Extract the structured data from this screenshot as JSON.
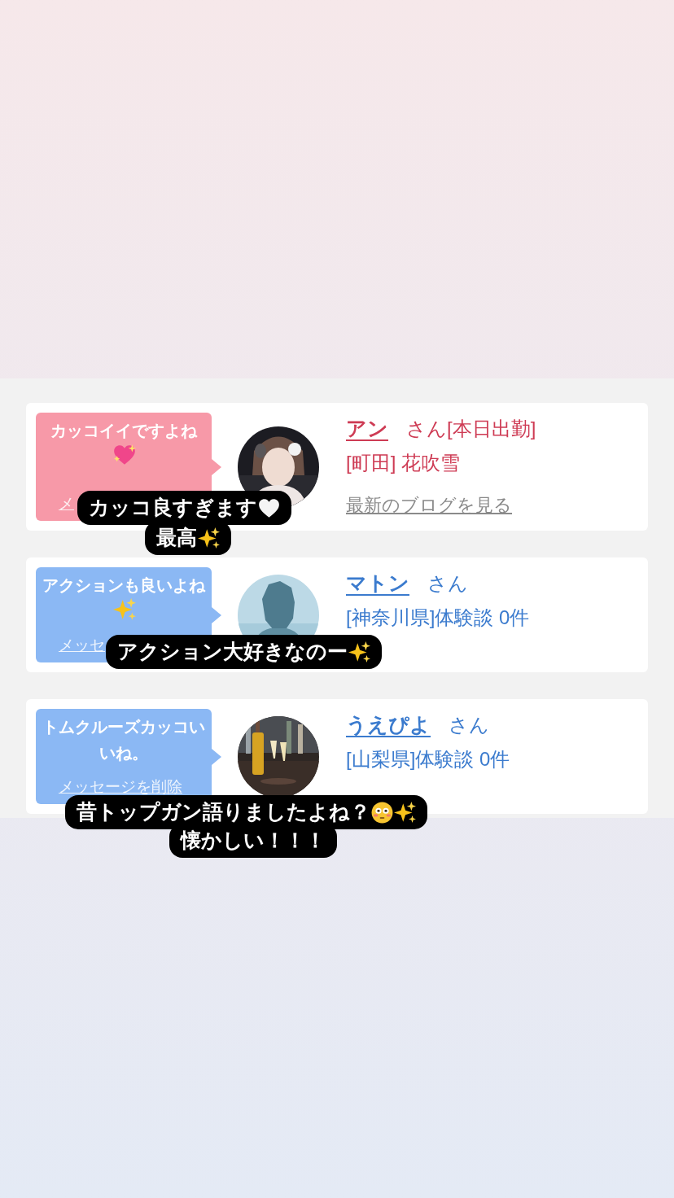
{
  "cards": [
    {
      "color": "#f799a8",
      "message": "カッコイイですよね",
      "message_icons": [
        {
          "kind": "sparkling-heart"
        }
      ],
      "delete_link": "メ",
      "name": "アン",
      "honorific": "さん[本日出勤]",
      "details": [
        "[町田] 花吹雪"
      ],
      "blog_link": "最新のブログを見る",
      "avatar": {
        "kind": "picture"
      }
    },
    {
      "color": "#8bb8f4",
      "message": "アクションも良いよね",
      "message_icons": [
        {
          "kind": "sparkles"
        }
      ],
      "delete_link": "メッセ",
      "name": "マトン",
      "honorific": "さん",
      "details": [
        "[神奈川県]体験談 0件"
      ],
      "avatar": {
        "kind": "picture"
      }
    },
    {
      "color": "#8bb8f4",
      "message": "トムクルーズカッコいいね。",
      "delete_link": "メッセージを削除",
      "name": "うえぴよ",
      "honorific": "さん",
      "details": [
        "[山梨県]体験談 0件"
      ],
      "avatar": {
        "kind": "picture"
      }
    }
  ],
  "captions": [
    {
      "lines": [
        {
          "text": "カッコ良すぎます",
          "icons": [
            {
              "kind": "white-heart"
            }
          ]
        },
        {
          "text": "最高",
          "icons": [
            {
              "kind": "sparkles"
            }
          ]
        }
      ]
    },
    {
      "lines": [
        {
          "text": "アクション大好きなのー",
          "icons": [
            {
              "kind": "sparkles"
            }
          ]
        }
      ]
    },
    {
      "lines": [
        {
          "text": "昔トップガン語りましたよね？",
          "icons": [
            {
              "kind": "flushed-face"
            },
            {
              "kind": "sparkles"
            }
          ]
        },
        {
          "text": "懐かしい！！！"
        }
      ]
    }
  ]
}
